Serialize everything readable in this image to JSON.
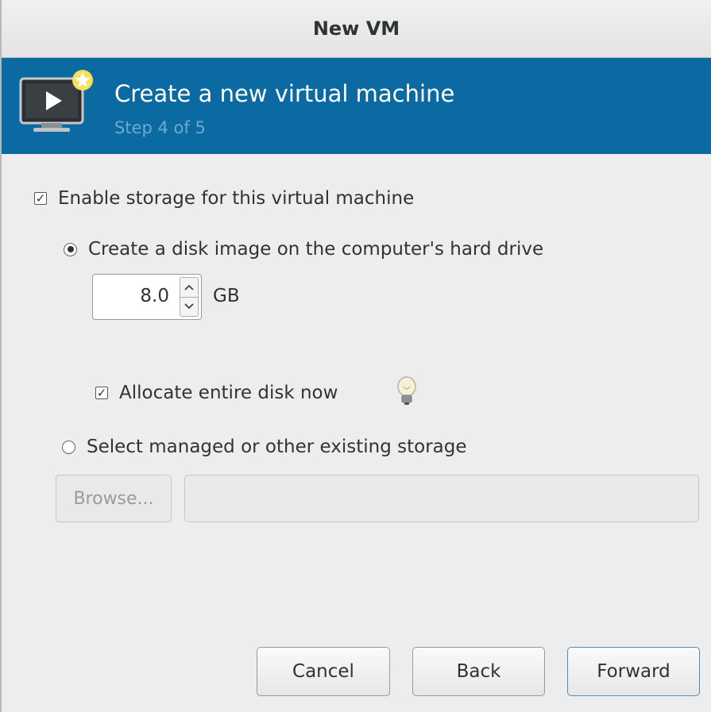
{
  "window": {
    "title": "New VM"
  },
  "header": {
    "title": "Create a new virtual machine",
    "step": "Step 4 of 5",
    "icon": "monitor-play-icon",
    "accent_color": "#0b6aa2"
  },
  "storage": {
    "enable_label": "Enable storage for this virtual machine",
    "enable_checked": true,
    "create_disk_label": "Create a disk image on the computer's hard drive",
    "create_disk_selected": true,
    "disk_size": "8.0",
    "disk_unit": "GB",
    "allocate_label": "Allocate entire disk now",
    "allocate_checked": true,
    "hint_icon": "lightbulb-icon",
    "managed_label": "Select managed or other existing storage",
    "managed_selected": false,
    "browse_label": "Browse...",
    "path_value": ""
  },
  "buttons": {
    "cancel": "Cancel",
    "back": "Back",
    "forward": "Forward"
  }
}
